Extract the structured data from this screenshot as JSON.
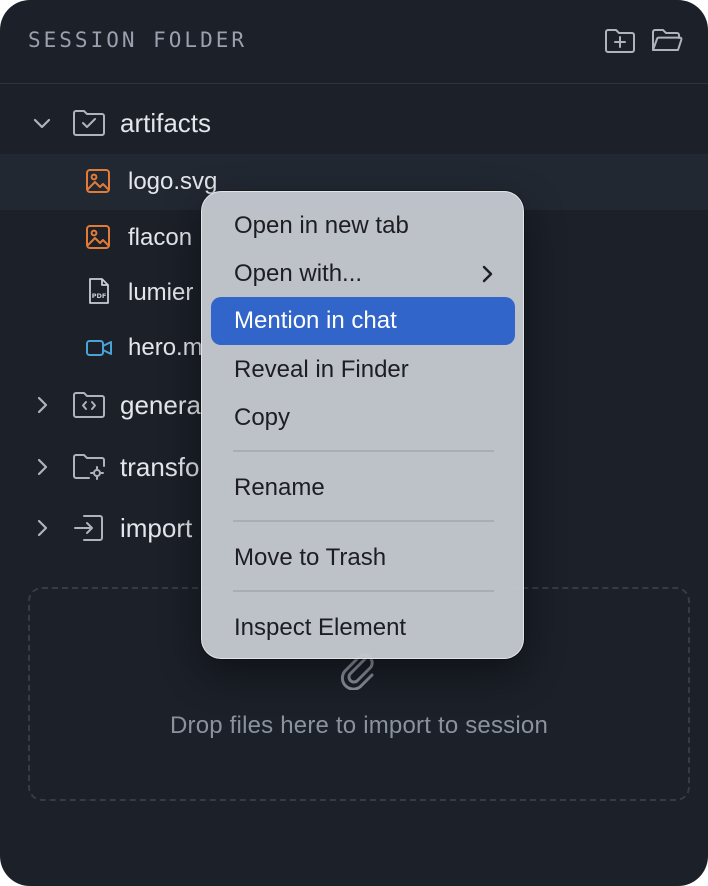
{
  "header": {
    "title": "SESSION FOLDER",
    "new_folder_icon": "folder-plus-icon",
    "open_folder_icon": "folder-open-icon"
  },
  "tree": {
    "artifacts": {
      "label": "artifacts",
      "expanded": true,
      "children": [
        {
          "label": "logo.svg",
          "icon": "image-icon",
          "color": "#e07b39"
        },
        {
          "label": "flacon",
          "icon": "image-icon",
          "color": "#e07b39"
        },
        {
          "label": "lumier",
          "icon": "pdf-file-icon",
          "color": "#c9ced6"
        },
        {
          "label": "hero.m",
          "icon": "video-icon",
          "color": "#4aa3d6"
        }
      ]
    },
    "folders": [
      {
        "label": "genera",
        "icon": "code-folder-icon"
      },
      {
        "label": "transfo",
        "icon": "folder-gear-icon"
      },
      {
        "label": "import",
        "icon": "import-icon"
      }
    ]
  },
  "dropzone": {
    "text": "Drop files here to import to session",
    "icon": "paperclip-icon"
  },
  "context_menu": {
    "items": [
      {
        "label": "Open in new tab"
      },
      {
        "label": "Open with...",
        "has_submenu": true
      },
      {
        "label": "Mention in chat",
        "active": true
      },
      {
        "label": "Reveal in Finder"
      },
      {
        "label": "Copy"
      },
      {
        "label": "Rename"
      },
      {
        "label": "Move to Trash"
      },
      {
        "label": "Inspect Element"
      }
    ],
    "accent": "#3165c9"
  }
}
